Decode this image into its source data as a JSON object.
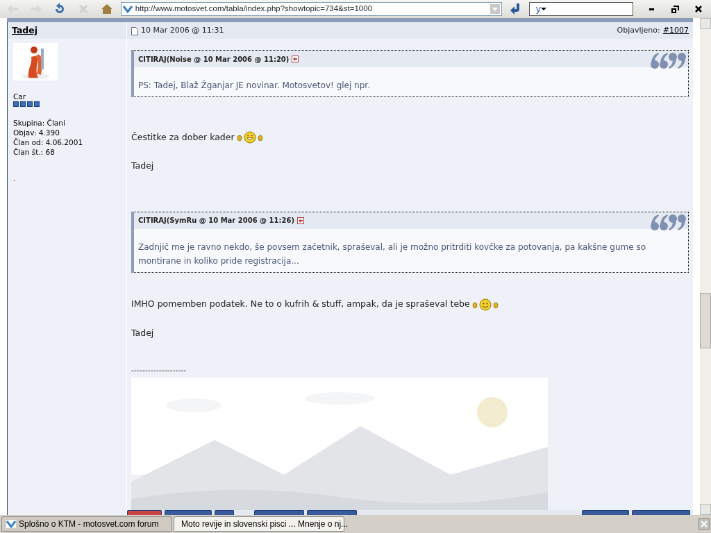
{
  "toolbar": {
    "address": "http://www.motosvet.com/tabla/index.php?showtopic=734&st=1000",
    "search_value": "y"
  },
  "post": {
    "author": "Tadej",
    "avatar": {
      "kind": "picture"
    },
    "member_title": "Car",
    "user_info": [
      "Skupina: Člani",
      "Objav: 4.390",
      "Član od: 4.06.2001",
      "Član št.: 68"
    ],
    "extra": ".",
    "date": "10 Mar 2006 @ 11:31",
    "posted_label": "Objavljeno:",
    "post_link": "#1007",
    "body": [
      {
        "kind": "quote",
        "header": "CITIRAJ(Noise @ 10 Mar 2006 @ 11:20)",
        "text": "PS: Tadej, Blaž Žganjar JE novinar. Motosvetov! glej npr."
      },
      {
        "kind": "paragraph",
        "text": "Čestitke za dober kader",
        "emoticon": true
      },
      {
        "kind": "paragraph",
        "text": "Tadej",
        "emoticon": false
      },
      {
        "kind": "quote",
        "header": "CITIRAJ(SymRu @ 10 Mar 2006 @ 11:26)",
        "text": "Zadnjič me je ravno nekdo, še povsem začetnik, spraševal, ali je možno pritrditi kovčke za potovanja, pa kakšne gume so montirane in koliko pride registracija..."
      },
      {
        "kind": "paragraph",
        "text": "IMHO pomemben podatek. Ne to o kufrih & stuff, ampak, da je spraševal tebe",
        "emoticon": true
      },
      {
        "kind": "paragraph",
        "text": "Tadej",
        "emoticon": false
      },
      {
        "kind": "rule",
        "text": "--------------------"
      },
      {
        "kind": "picture"
      }
    ]
  },
  "tabs": [
    {
      "title": "Splošno o KTM - motosvet.com forum",
      "selected": false
    },
    {
      "title": "Moto revije in slovenski pisci ... Mnenje o nj...",
      "selected": true
    }
  ]
}
